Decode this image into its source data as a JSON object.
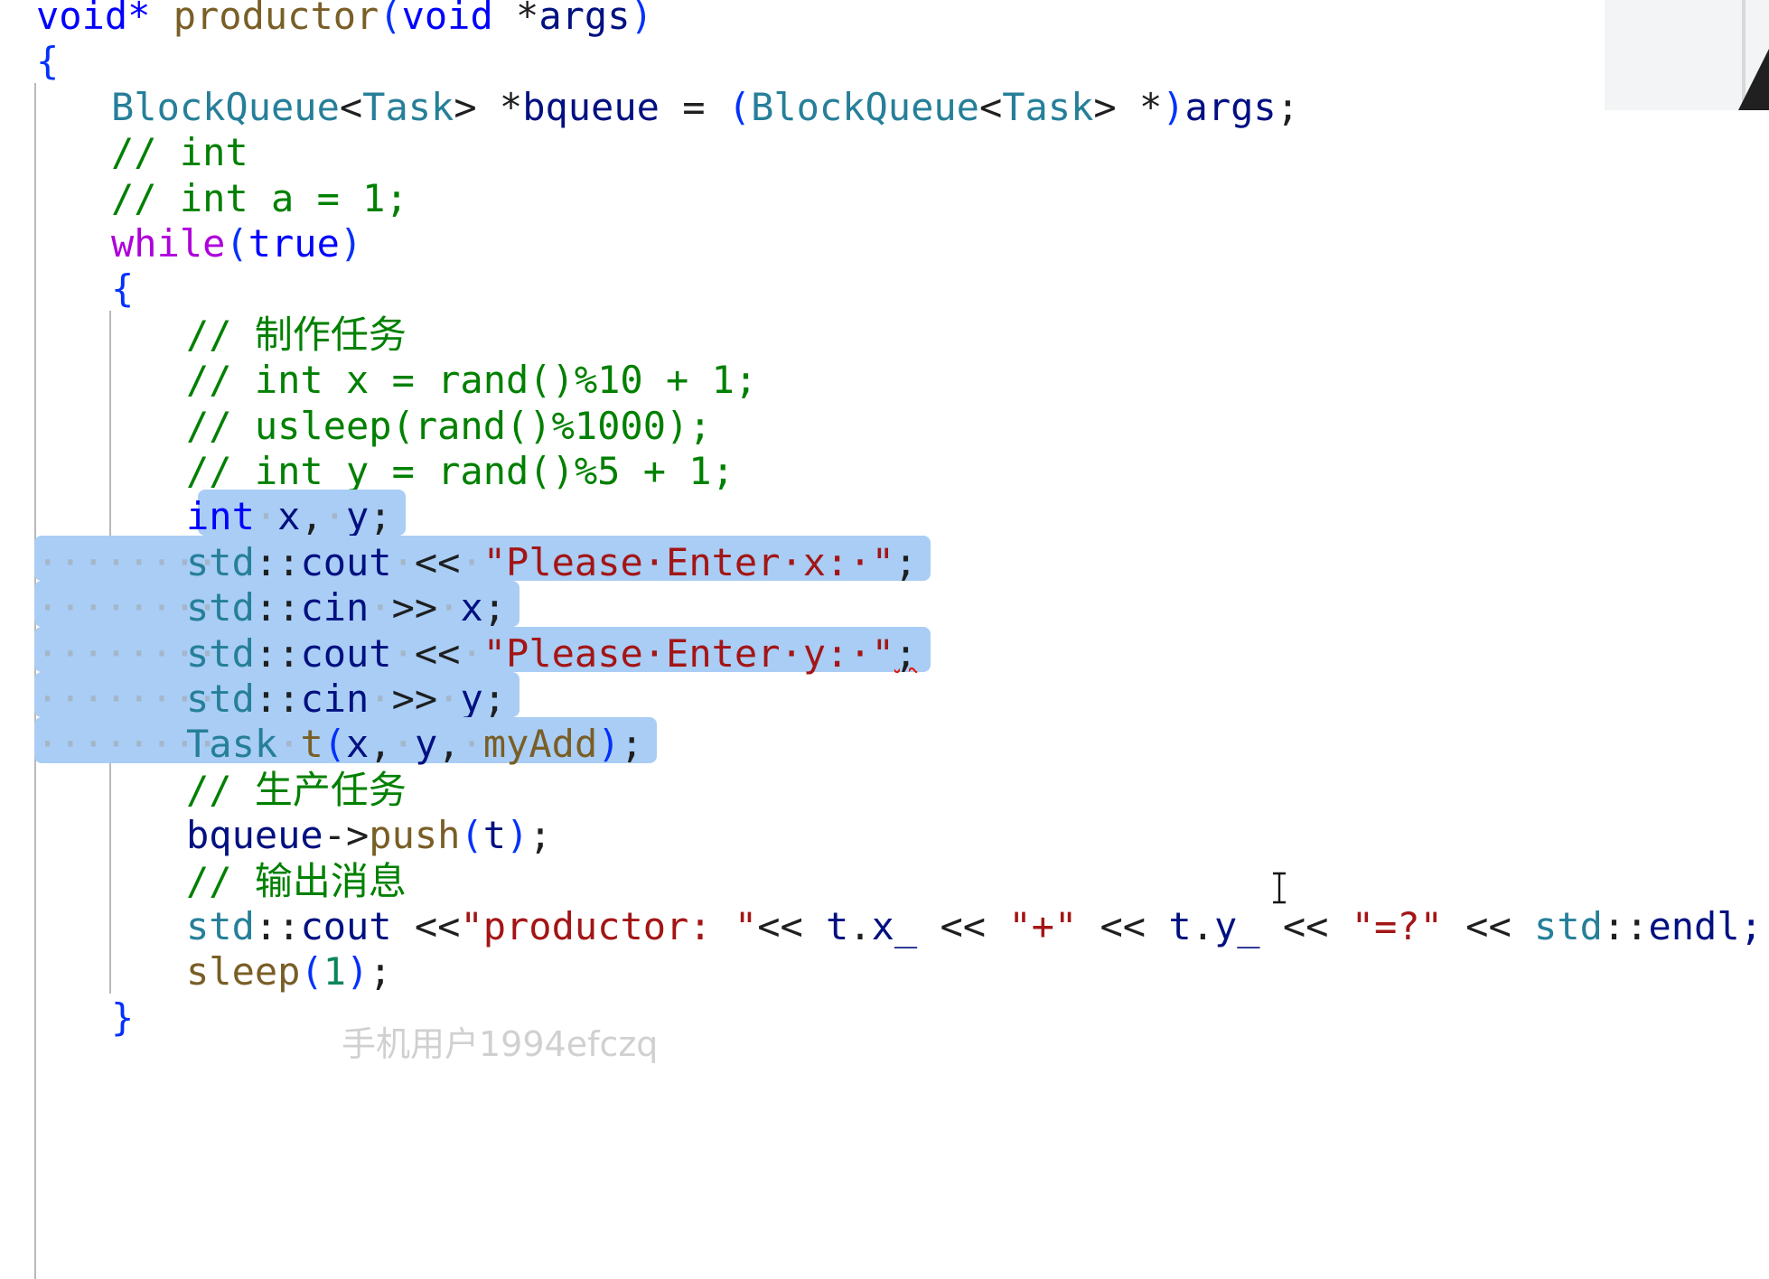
{
  "editor": {
    "lines": [
      {
        "indent": 0,
        "tokens": [
          {
            "t": "void*",
            "c": "kw"
          },
          {
            "t": " ",
            "c": ""
          },
          {
            "t": "productor",
            "c": "fn"
          },
          {
            "t": "(",
            "c": "pn"
          },
          {
            "t": "void",
            "c": "kw"
          },
          {
            "t": " *",
            "c": ""
          },
          {
            "t": "args",
            "c": "var"
          },
          {
            "t": ")",
            "c": "pn"
          }
        ]
      },
      {
        "indent": 0,
        "tokens": [
          {
            "t": "{",
            "c": "pn"
          }
        ]
      },
      {
        "indent": 1,
        "tokens": [
          {
            "t": "BlockQueue",
            "c": "ty"
          },
          {
            "t": "<",
            "c": ""
          },
          {
            "t": "Task",
            "c": "ty"
          },
          {
            "t": "> *",
            "c": ""
          },
          {
            "t": "bqueue",
            "c": "var"
          },
          {
            "t": " = ",
            "c": ""
          },
          {
            "t": "(",
            "c": "pn"
          },
          {
            "t": "BlockQueue",
            "c": "ty"
          },
          {
            "t": "<",
            "c": ""
          },
          {
            "t": "Task",
            "c": "ty"
          },
          {
            "t": "> *",
            "c": ""
          },
          {
            "t": ")",
            "c": "pn"
          },
          {
            "t": "args",
            "c": "var"
          },
          {
            "t": ";",
            "c": ""
          }
        ]
      },
      {
        "indent": 1,
        "tokens": [
          {
            "t": "// int",
            "c": "cm"
          }
        ]
      },
      {
        "indent": 1,
        "tokens": [
          {
            "t": "// int a = 1;",
            "c": "cm"
          }
        ]
      },
      {
        "indent": 1,
        "tokens": [
          {
            "t": "while",
            "c": "ctl"
          },
          {
            "t": "(",
            "c": "pn"
          },
          {
            "t": "true",
            "c": "kw"
          },
          {
            "t": ")",
            "c": "pn"
          }
        ]
      },
      {
        "indent": 1,
        "tokens": [
          {
            "t": "{",
            "c": "pn"
          }
        ]
      },
      {
        "indent": 2,
        "tokens": [
          {
            "t": "// 制作任务",
            "c": "cm"
          }
        ]
      },
      {
        "indent": 2,
        "tokens": [
          {
            "t": "// int x = rand()%10 + 1;",
            "c": "cm"
          }
        ]
      },
      {
        "indent": 2,
        "tokens": [
          {
            "t": "// usleep(rand()%1000);",
            "c": "cm"
          }
        ]
      },
      {
        "indent": 2,
        "tokens": [
          {
            "t": "// int y = rand()%5 + 1;",
            "c": "cm"
          }
        ]
      },
      {
        "indent": 2,
        "selected": true,
        "tokens": [
          {
            "t": "int",
            "c": "kw"
          },
          {
            "t": "·",
            "c": "ws"
          },
          {
            "t": "x",
            "c": "var"
          },
          {
            "t": ",",
            "c": ""
          },
          {
            "t": "·",
            "c": "ws"
          },
          {
            "t": "y",
            "c": "var"
          },
          {
            "t": ";",
            "c": ""
          }
        ]
      },
      {
        "indent": 2,
        "selected": true,
        "tokens": [
          {
            "t": "std",
            "c": "ty"
          },
          {
            "t": "::",
            "c": ""
          },
          {
            "t": "cout",
            "c": "var"
          },
          {
            "t": "·",
            "c": "ws"
          },
          {
            "t": "<<",
            "c": ""
          },
          {
            "t": "·",
            "c": "ws"
          },
          {
            "t": "\"Please·Enter·x:·\"",
            "c": "str"
          },
          {
            "t": ";",
            "c": ""
          }
        ]
      },
      {
        "indent": 2,
        "selected": true,
        "tokens": [
          {
            "t": "std",
            "c": "ty"
          },
          {
            "t": "::",
            "c": ""
          },
          {
            "t": "cin",
            "c": "var"
          },
          {
            "t": "·",
            "c": "ws"
          },
          {
            "t": ">>",
            "c": ""
          },
          {
            "t": "·",
            "c": "ws"
          },
          {
            "t": "x",
            "c": "var"
          },
          {
            "t": ";",
            "c": ""
          }
        ]
      },
      {
        "indent": 2,
        "selected": true,
        "tokens": [
          {
            "t": "std",
            "c": "ty"
          },
          {
            "t": "::",
            "c": ""
          },
          {
            "t": "cout",
            "c": "var"
          },
          {
            "t": "·",
            "c": "ws"
          },
          {
            "t": "<<",
            "c": ""
          },
          {
            "t": "·",
            "c": "ws"
          },
          {
            "t": "\"Please·Enter·y:·\"",
            "c": "str"
          },
          {
            "t": ";",
            "c": "squiggle"
          }
        ]
      },
      {
        "indent": 2,
        "selected": true,
        "tokens": [
          {
            "t": "std",
            "c": "ty"
          },
          {
            "t": "::",
            "c": ""
          },
          {
            "t": "cin",
            "c": "var"
          },
          {
            "t": "·",
            "c": "ws"
          },
          {
            "t": ">>",
            "c": ""
          },
          {
            "t": "·",
            "c": "ws"
          },
          {
            "t": "y",
            "c": "var"
          },
          {
            "t": ";",
            "c": ""
          }
        ]
      },
      {
        "indent": 2,
        "selected": true,
        "tokens": [
          {
            "t": "Task",
            "c": "ty"
          },
          {
            "t": "·",
            "c": "ws"
          },
          {
            "t": "t",
            "c": "fn"
          },
          {
            "t": "(",
            "c": "pn"
          },
          {
            "t": "x",
            "c": "var"
          },
          {
            "t": ",",
            "c": ""
          },
          {
            "t": "·",
            "c": "ws"
          },
          {
            "t": "y",
            "c": "var"
          },
          {
            "t": ",",
            "c": ""
          },
          {
            "t": "·",
            "c": "ws"
          },
          {
            "t": "myAdd",
            "c": "fn"
          },
          {
            "t": ")",
            "c": "pn"
          },
          {
            "t": ";",
            "c": ""
          }
        ]
      },
      {
        "indent": 2,
        "tokens": [
          {
            "t": "// 生产任务",
            "c": "cm"
          }
        ]
      },
      {
        "indent": 2,
        "tokens": [
          {
            "t": "bqueue",
            "c": "var"
          },
          {
            "t": "->",
            "c": ""
          },
          {
            "t": "push",
            "c": "fn"
          },
          {
            "t": "(",
            "c": "pn"
          },
          {
            "t": "t",
            "c": "var"
          },
          {
            "t": ")",
            "c": "pn"
          },
          {
            "t": ";",
            "c": ""
          }
        ]
      },
      {
        "indent": 2,
        "tokens": [
          {
            "t": "// 输出消息",
            "c": "cm"
          }
        ]
      },
      {
        "indent": 2,
        "tokens": [
          {
            "t": "std",
            "c": "ty"
          },
          {
            "t": "::",
            "c": ""
          },
          {
            "t": "cout",
            "c": "var"
          },
          {
            "t": " <<",
            "c": ""
          },
          {
            "t": "\"productor: \"",
            "c": "str"
          },
          {
            "t": "<< ",
            "c": ""
          },
          {
            "t": "t",
            "c": "var"
          },
          {
            "t": ".",
            "c": ""
          },
          {
            "t": "x_",
            "c": "var"
          },
          {
            "t": " << ",
            "c": ""
          },
          {
            "t": "\"+\"",
            "c": "str"
          },
          {
            "t": " << ",
            "c": ""
          },
          {
            "t": "t",
            "c": "var"
          },
          {
            "t": ".",
            "c": ""
          },
          {
            "t": "y_",
            "c": "var"
          },
          {
            "t": " << ",
            "c": ""
          },
          {
            "t": "\"=?\"",
            "c": "str"
          },
          {
            "t": " << ",
            "c": ""
          },
          {
            "t": "std",
            "c": "ty"
          },
          {
            "t": "::",
            "c": ""
          },
          {
            "t": "endl;",
            "c": "var"
          }
        ]
      },
      {
        "indent": 2,
        "tokens": [
          {
            "t": "sleep",
            "c": "fn"
          },
          {
            "t": "(",
            "c": "pn"
          },
          {
            "t": "1",
            "c": "num"
          },
          {
            "t": ")",
            "c": "pn"
          },
          {
            "t": ";",
            "c": ""
          }
        ]
      },
      {
        "indent": 1,
        "tokens": [
          {
            "t": "}",
            "c": "pn"
          }
        ]
      }
    ]
  },
  "watermark": "手机用户1994efczq",
  "cursor_icon": "i-beam-cursor-icon",
  "colors": {
    "selection": "#a9cdf5",
    "keyword": "#0000ff",
    "control": "#af00db",
    "type": "#267f99",
    "function": "#795e26",
    "string": "#a31515",
    "comment": "#008000",
    "number": "#098658"
  }
}
